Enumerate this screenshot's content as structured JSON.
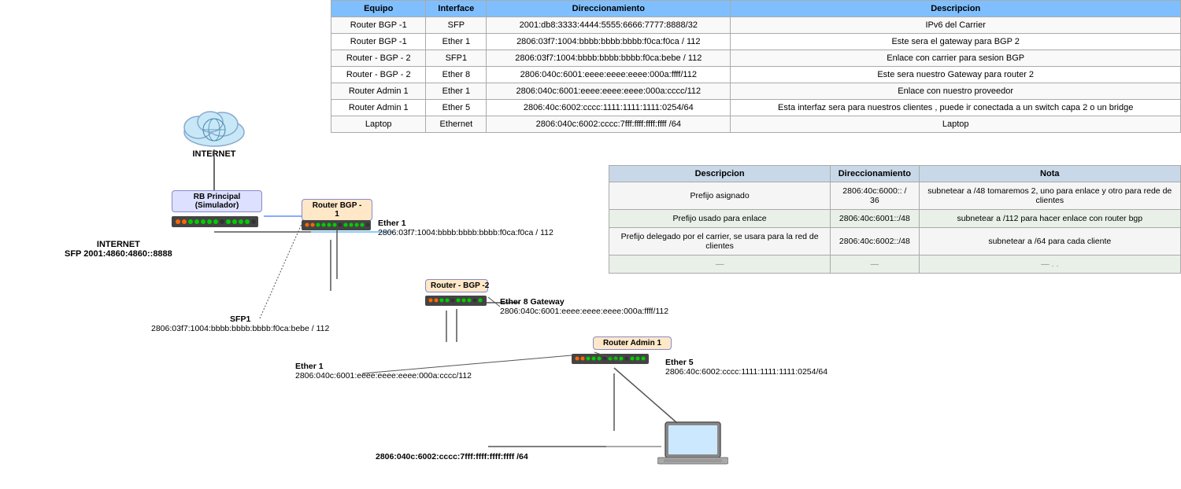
{
  "table": {
    "headers": [
      "Equipo",
      "Interface",
      "Direccionamiento",
      "Descripcion"
    ],
    "rows": [
      {
        "equipo": "Router BGP -1",
        "interface": "SFP",
        "direccionamiento": "2001:db8:3333:4444:5555:6666:7777:8888/32",
        "descripcion": "IPv6 del Carrier"
      },
      {
        "equipo": "Router BGP -1",
        "interface": "Ether 1",
        "direccionamiento": "2806:03f7:1004:bbbb:bbbb:bbbb:f0ca:f0ca / 112",
        "descripcion": "Este sera el gateway para BGP 2"
      },
      {
        "equipo": "Router - BGP - 2",
        "interface": "SFP1",
        "direccionamiento": "2806:03f7:1004:bbbb:bbbb:bbbb:f0ca:bebe / 112",
        "descripcion": "Enlace con carrier para sesion BGP"
      },
      {
        "equipo": "Router - BGP - 2",
        "interface": "Ether 8",
        "direccionamiento": "2806:040c:6001:eeee:eeee:eeee:000a:ffff/112",
        "descripcion": "Este sera nuestro Gateway para router 2"
      },
      {
        "equipo": "Router Admin 1",
        "interface": "Ether 1",
        "direccionamiento": "2806:040c:6001:eeee:eeee:eeee:000a:cccc/112",
        "descripcion": "Enlace con nuestro proveedor"
      },
      {
        "equipo": "Router Admin 1",
        "interface": "Ether 5",
        "direccionamiento": "2806:40c:6002:cccc:1111:1111:1111:0254/64",
        "descripcion": "Esta interfaz sera para nuestros clientes , puede ir conectada a un switch capa 2 o un bridge"
      },
      {
        "equipo": "Laptop",
        "interface": "Ethernet",
        "direccionamiento": "2806:040c:6002:cccc:7fff:ffff:ffff:ffff /64",
        "descripcion": "Laptop"
      }
    ]
  },
  "lower_table": {
    "headers": [
      "Descripcion",
      "Direccionamiento",
      "Nota"
    ],
    "rows": [
      {
        "descripcion": "Prefijo asignado",
        "direccionamiento": "2806:40c:6000:: / 36",
        "nota": "subnetear a /48  tomaremos 2, uno para enlace y otro para rede de clientes"
      },
      {
        "descripcion": "Prefijo usado para enlace",
        "direccionamiento": "2806:40c:6001::/48",
        "nota": "subnetear a /112 para hacer enlace con router bgp"
      },
      {
        "descripcion": "Prefijo delegado por el carrier, se usara para la red de clientes",
        "direccionamiento": "2806:40c:6002::/48",
        "nota": "subnetear a /64 para cada cliente"
      },
      {
        "descripcion": "—",
        "direccionamiento": "—",
        "nota": "— . ."
      }
    ]
  },
  "diagram": {
    "internet_label": "INTERNET",
    "rb_principal_label": "RB Principal\n(Simulador)",
    "router_bgp1_label": "Router BGP -\n1",
    "router_bgp2_label": "Router - BGP -2",
    "router_admin1_label": "Router Admin 1",
    "internet_sfp_label": "INTERNET\nSFP 2001:4860:4860::8888",
    "ether1_label1": "Ether 1\n2806:03f7:1004:bbbb:bbbb:bbbb:f0ca:f0ca / 112",
    "sfp1_label": "SFP1\n2806:03f7:1004:bbbb:bbbb:bbbb:f0ca:bebe / 112",
    "ether8_label": "Ether 8 Gateway\n2806:040c:6001:eeee:eeee:eeee:000a:ffff/112",
    "ether1_label2": "Ether 1\n2806:040c:6001:eeee:eeee:eeee:000a:cccc/112",
    "ether5_label": "Ether 5\n2806:40c:6002:cccc:1111:1111:1111:0254/64",
    "laptop_label": "2806:040c:6002:cccc:7fff:ffff:ffff:ffff /64"
  }
}
